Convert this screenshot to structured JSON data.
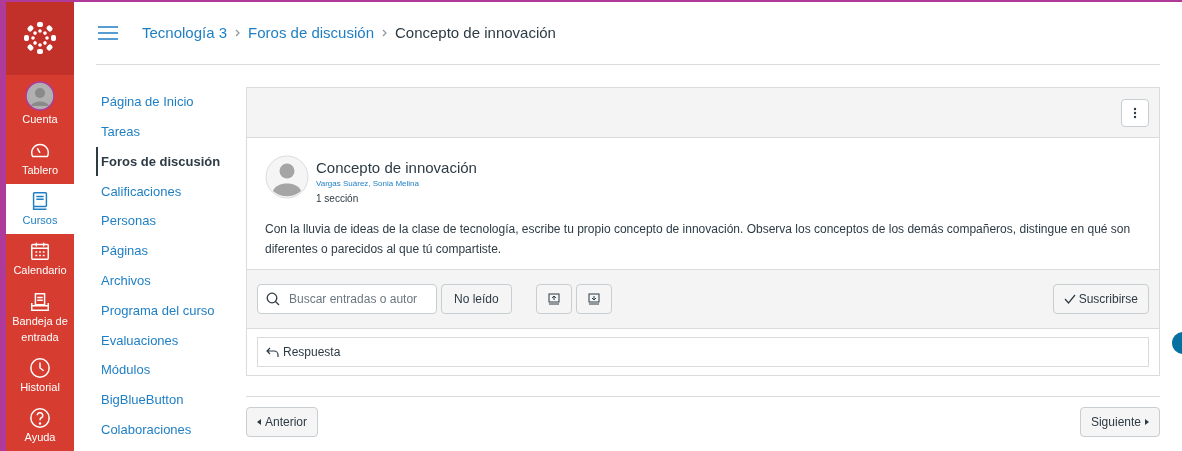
{
  "global_nav": [
    {
      "kind": "account",
      "label": "Cuenta",
      "selected": false
    },
    {
      "kind": "dashboard",
      "label": "Tablero",
      "selected": false
    },
    {
      "kind": "courses",
      "label": "Cursos",
      "selected": true
    },
    {
      "kind": "calendar",
      "label": "Calendario",
      "selected": false
    },
    {
      "kind": "inbox",
      "label": "Bandeja de entrada",
      "selected": false
    },
    {
      "kind": "history",
      "label": "Historial",
      "selected": false
    },
    {
      "kind": "help",
      "label": "Ayuda",
      "selected": false
    }
  ],
  "breadcrumb": [
    "Tecnología 3",
    "Foros de discusión",
    "Concepto de innovación"
  ],
  "course_nav": [
    {
      "label": "Página de Inicio",
      "selected": false
    },
    {
      "label": "Tareas",
      "selected": false
    },
    {
      "label": "Foros de discusión",
      "selected": true
    },
    {
      "label": "Calificaciones",
      "selected": false
    },
    {
      "label": "Personas",
      "selected": false
    },
    {
      "label": "Páginas",
      "selected": false
    },
    {
      "label": "Archivos",
      "selected": false
    },
    {
      "label": "Programa del curso",
      "selected": false
    },
    {
      "label": "Evaluaciones",
      "selected": false
    },
    {
      "label": "Módulos",
      "selected": false
    },
    {
      "label": "BigBlueButton",
      "selected": false
    },
    {
      "label": "Colaboraciones",
      "selected": false
    }
  ],
  "post": {
    "title": "Concepto de innovación",
    "author": "Vargas Suárez, Sonia Melina",
    "sections": "1 sección",
    "body": "Con la lluvia de ideas de la clase de tecnología, escribe tu propio concepto de innovación. Observa los conceptos de los demás compañeros, distingue en qué son diferentes o parecidos al que tú compartiste."
  },
  "toolbar": {
    "search": {
      "placeholder": "Buscar entradas o autor"
    },
    "unread": "No leído",
    "subscribe": "Suscribirse"
  },
  "reply": "Respuesta",
  "pager": {
    "previous": "Anterior",
    "next": "Siguiente"
  }
}
